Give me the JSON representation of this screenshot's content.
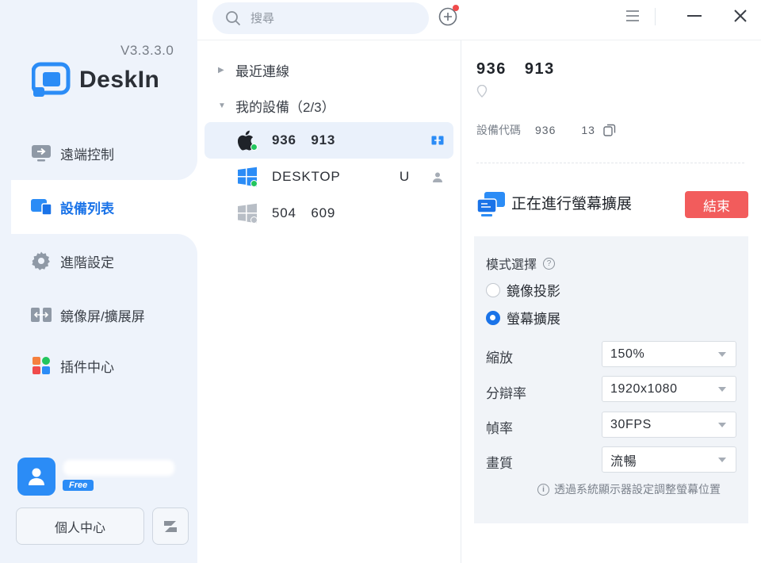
{
  "app": {
    "version": "V3.3.3.0",
    "logo_text": "DeskIn",
    "brand_color": "#2b8cf6"
  },
  "sidebar": {
    "items": [
      {
        "label": "遠端控制",
        "icon": "remote-control-icon",
        "active": false
      },
      {
        "label": "設備列表",
        "icon": "device-list-icon",
        "active": true
      },
      {
        "label": "進階設定",
        "icon": "gear-icon",
        "active": false
      },
      {
        "label": "鏡像屏/擴展屏",
        "icon": "mirror-extend-icon",
        "active": false
      },
      {
        "label": "插件中心",
        "icon": "plugin-grid-icon",
        "active": false
      }
    ],
    "user": {
      "badge": "Free",
      "profile_button": "個人中心"
    }
  },
  "topbar": {
    "search_placeholder": "搜尋"
  },
  "device_list": {
    "recent_group": "最近連線",
    "my_devices_group": "我的設備（2/3）",
    "devices": [
      {
        "name": "936  913",
        "os": "apple-icon",
        "status": "online",
        "selected": true
      },
      {
        "name": "DESKTOP        U",
        "os": "windows-icon",
        "status": "online",
        "selected": false
      },
      {
        "name": "504  609",
        "os": "windows-icon",
        "status": "offline",
        "selected": false
      }
    ]
  },
  "details": {
    "device_id": "936  913",
    "code_label": "設備代碼",
    "code_value": "936    13",
    "extension_title": "正在進行螢幕擴展",
    "end_button": "結束",
    "end_color": "#f25c5c",
    "mode_title": "模式選擇",
    "modes": [
      {
        "label": "鏡像投影",
        "selected": false
      },
      {
        "label": "螢幕擴展",
        "selected": true
      }
    ],
    "fields": [
      {
        "label": "縮放",
        "value": "150%"
      },
      {
        "label": "分辯率",
        "value": "1920x1080"
      },
      {
        "label": "幀率",
        "value": "30FPS"
      },
      {
        "label": "畫質",
        "value": "流暢"
      }
    ],
    "hint": "透過系統顯示器設定調整螢幕位置"
  }
}
